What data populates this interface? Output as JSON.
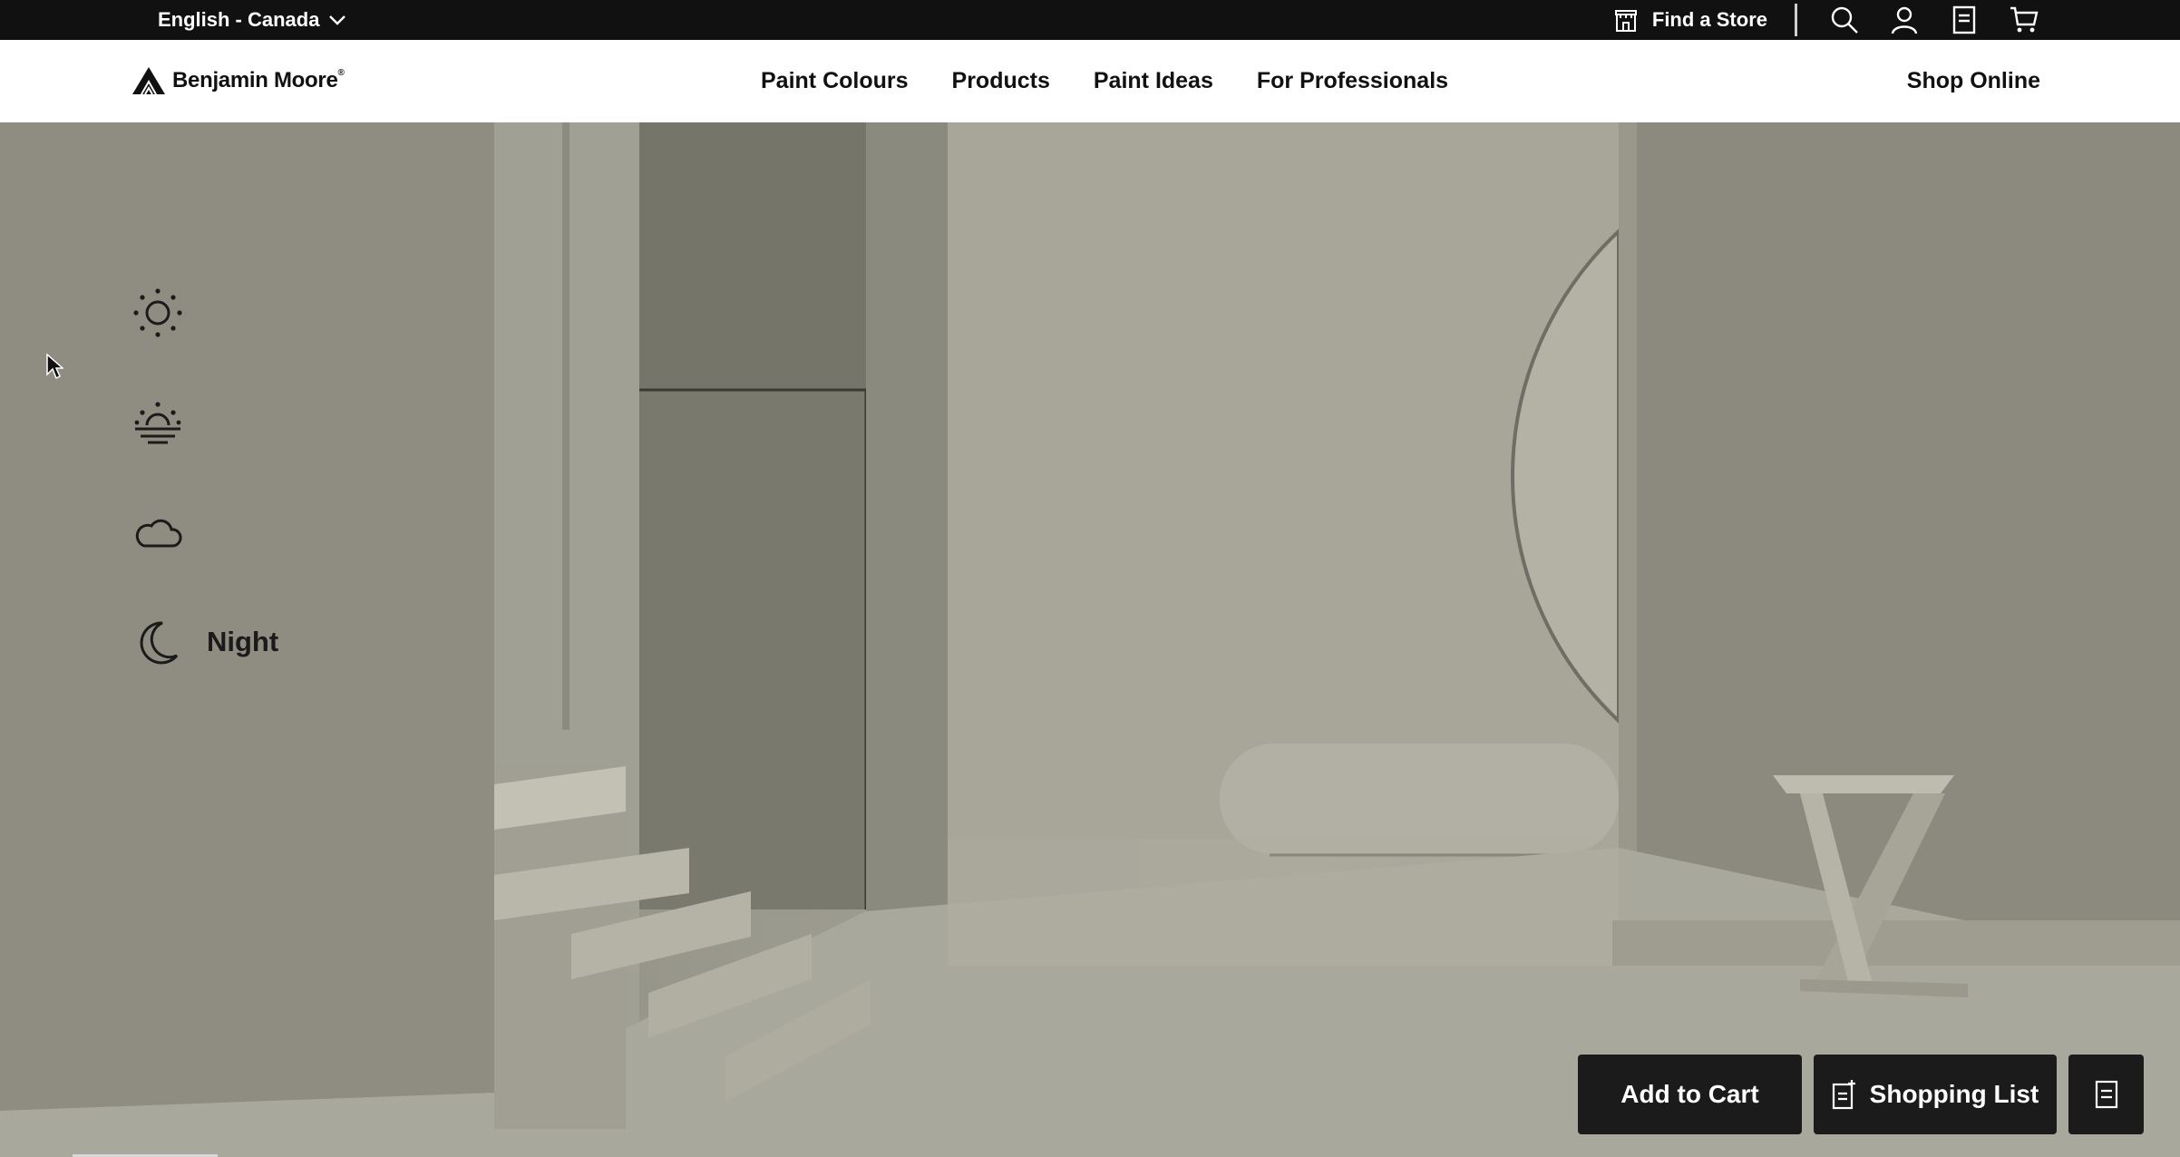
{
  "topbar": {
    "language": "English - Canada",
    "find_store": "Find a Store",
    "icons": [
      "search-icon",
      "account-icon",
      "list-icon",
      "cart-icon"
    ]
  },
  "nav": {
    "brand": "Benjamin Moore",
    "brand_mark": "®",
    "links": [
      "Paint Colours",
      "Products",
      "Paint Ideas",
      "For Professionals"
    ],
    "shop": "Shop Online"
  },
  "lighting": {
    "options": [
      {
        "icon": "sun-icon",
        "label": ""
      },
      {
        "icon": "sunrise-icon",
        "label": ""
      },
      {
        "icon": "cloud-icon",
        "label": ""
      },
      {
        "icon": "moon-icon",
        "label": "Night"
      }
    ],
    "active": "Night"
  },
  "actions": {
    "add_to_cart": "Add to Cart",
    "shopping_list": "Shopping List"
  },
  "colors": {
    "topbar": "#111111",
    "button": "#1b1b1b",
    "scene_wall": "#9d9c90"
  }
}
